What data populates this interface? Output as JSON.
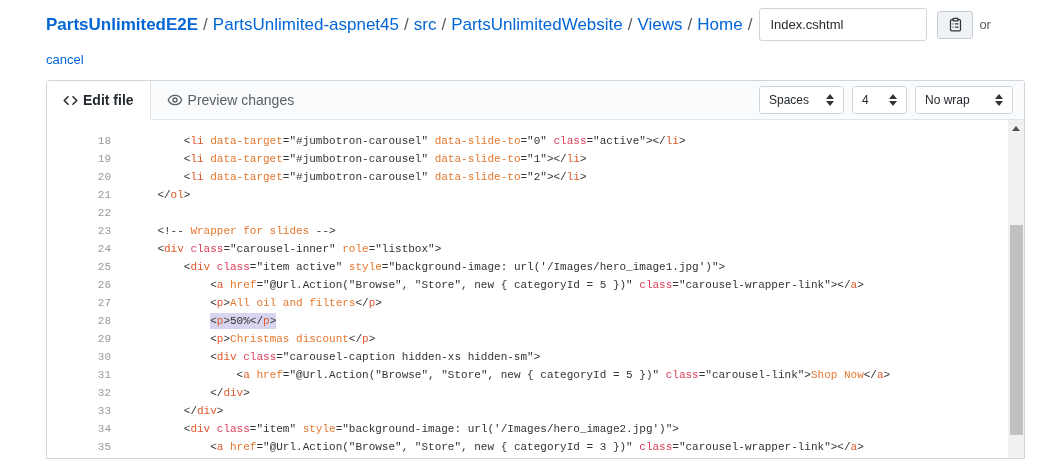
{
  "breadcrumb": [
    {
      "label": "PartsUnlimitedE2E",
      "kind": "repo",
      "separator": "/"
    },
    {
      "label": "PartsUnlimited-aspnet45",
      "kind": "dir",
      "separator": "/"
    },
    {
      "label": "src",
      "kind": "dir",
      "separator": "/"
    },
    {
      "label": "PartsUnlimitedWebsite",
      "kind": "dir",
      "separator": "/"
    },
    {
      "label": "Views",
      "kind": "dir",
      "separator": "/"
    },
    {
      "label": "Home",
      "kind": "dir",
      "separator": "/"
    }
  ],
  "filename": {
    "value": "Index.cshtml"
  },
  "or_text": "or",
  "cancel_link": "cancel",
  "tabs": [
    {
      "label": "Edit file",
      "selected": true
    },
    {
      "label": "Preview changes",
      "selected": false
    }
  ],
  "selects": [
    {
      "value": "Spaces"
    },
    {
      "value": "4"
    },
    {
      "value": "No wrap"
    }
  ],
  "code_lines": [
    {
      "number": "18",
      "selected": false,
      "tokens": [
        {
          "kind": "punct",
          "text": "        <"
        },
        {
          "kind": "tag",
          "text": "li"
        },
        {
          "kind": "attr",
          "text": " data-target"
        },
        {
          "kind": "punct",
          "text": "=\"#jumbotron-carousel\""
        },
        {
          "kind": "attr",
          "text": " data-slide-to"
        },
        {
          "kind": "punct",
          "text": "=\"0\""
        },
        {
          "kind": "keyword",
          "text": " class"
        },
        {
          "kind": "punct",
          "text": "=\"active\"></"
        },
        {
          "kind": "tag",
          "text": "li"
        },
        {
          "kind": "punct",
          "text": ">"
        }
      ]
    },
    {
      "number": "19",
      "selected": false,
      "tokens": [
        {
          "kind": "punct",
          "text": "        <"
        },
        {
          "kind": "tag",
          "text": "li"
        },
        {
          "kind": "attr",
          "text": " data-target"
        },
        {
          "kind": "punct",
          "text": "=\"#jumbotron-carousel\""
        },
        {
          "kind": "attr",
          "text": " data-slide-to"
        },
        {
          "kind": "punct",
          "text": "=\"1\"></"
        },
        {
          "kind": "tag",
          "text": "li"
        },
        {
          "kind": "punct",
          "text": ">"
        }
      ]
    },
    {
      "number": "20",
      "selected": false,
      "tokens": [
        {
          "kind": "punct",
          "text": "        <"
        },
        {
          "kind": "tag",
          "text": "li"
        },
        {
          "kind": "attr",
          "text": " data-target"
        },
        {
          "kind": "punct",
          "text": "=\"#jumbotron-carousel\""
        },
        {
          "kind": "attr",
          "text": " data-slide-to"
        },
        {
          "kind": "punct",
          "text": "=\"2\"></"
        },
        {
          "kind": "tag",
          "text": "li"
        },
        {
          "kind": "punct",
          "text": ">"
        }
      ]
    },
    {
      "number": "21",
      "selected": false,
      "tokens": [
        {
          "kind": "punct",
          "text": "    </"
        },
        {
          "kind": "tag",
          "text": "ol"
        },
        {
          "kind": "punct",
          "text": ">"
        }
      ]
    },
    {
      "number": "22"
    },
    {
      "number": "23",
      "selected": false,
      "tokens": [
        {
          "kind": "punct",
          "text": "    <!--"
        },
        {
          "kind": "comment",
          "text": " Wrapper for slides"
        },
        {
          "kind": "punct",
          "text": " -->"
        }
      ]
    },
    {
      "number": "24",
      "selected": false,
      "tokens": [
        {
          "kind": "punct",
          "text": "    <"
        },
        {
          "kind": "tag",
          "text": "div"
        },
        {
          "kind": "keyword",
          "text": " class"
        },
        {
          "kind": "punct",
          "text": "=\"carousel-inner\""
        },
        {
          "kind": "attr",
          "text": " role"
        },
        {
          "kind": "punct",
          "text": "=\"listbox\">"
        }
      ]
    },
    {
      "number": "25",
      "selected": false,
      "tokens": [
        {
          "kind": "punct",
          "text": "        <"
        },
        {
          "kind": "tag",
          "text": "div"
        },
        {
          "kind": "keyword",
          "text": " class"
        },
        {
          "kind": "punct",
          "text": "=\"item active\""
        },
        {
          "kind": "attr",
          "text": " style"
        },
        {
          "kind": "punct",
          "text": "=\"background-image: url('/Images/hero_image1.jpg')\">"
        }
      ]
    },
    {
      "number": "26",
      "selected": false,
      "tokens": [
        {
          "kind": "punct",
          "text": "            <"
        },
        {
          "kind": "tag",
          "text": "a"
        },
        {
          "kind": "attr",
          "text": " href"
        },
        {
          "kind": "punct",
          "text": "=\"@Url.Action(\"Browse\", \"Store\", new { categoryId = 5 })\""
        },
        {
          "kind": "keyword",
          "text": " class"
        },
        {
          "kind": "punct",
          "text": "=\"carousel-wrapper-link\"></"
        },
        {
          "kind": "tag",
          "text": "a"
        },
        {
          "kind": "punct",
          "text": ">"
        }
      ]
    },
    {
      "number": "27",
      "selected": false,
      "tokens": [
        {
          "kind": "punct",
          "text": "            <"
        },
        {
          "kind": "tag",
          "text": "p"
        },
        {
          "kind": "punct",
          "text": ">"
        },
        {
          "kind": "content",
          "text": "All oil and filters"
        },
        {
          "kind": "punct",
          "text": "</"
        },
        {
          "kind": "tag",
          "text": "p"
        },
        {
          "kind": "punct",
          "text": ">"
        }
      ]
    },
    {
      "number": "28",
      "selected": true,
      "tokens": [
        {
          "kind": "punct",
          "text": "            <"
        },
        {
          "kind": "tag",
          "text": "p"
        },
        {
          "kind": "punct",
          "text": ">50%</"
        },
        {
          "kind": "tag",
          "text": "p"
        },
        {
          "kind": "punct",
          "text": ">"
        }
      ]
    },
    {
      "number": "29",
      "selected": false,
      "tokens": [
        {
          "kind": "punct",
          "text": "            <"
        },
        {
          "kind": "tag",
          "text": "p"
        },
        {
          "kind": "punct",
          "text": ">"
        },
        {
          "kind": "content",
          "text": "Christmas discount"
        },
        {
          "kind": "punct",
          "text": "</"
        },
        {
          "kind": "tag",
          "text": "p"
        },
        {
          "kind": "punct",
          "text": ">"
        }
      ]
    },
    {
      "number": "30",
      "selected": false,
      "tokens": [
        {
          "kind": "punct",
          "text": "            <"
        },
        {
          "kind": "tag",
          "text": "div"
        },
        {
          "kind": "keyword",
          "text": " class"
        },
        {
          "kind": "punct",
          "text": "=\"carousel-caption hidden-xs hidden-sm\">"
        }
      ]
    },
    {
      "number": "31",
      "selected": false,
      "tokens": [
        {
          "kind": "punct",
          "text": "                <"
        },
        {
          "kind": "tag",
          "text": "a"
        },
        {
          "kind": "attr",
          "text": " href"
        },
        {
          "kind": "punct",
          "text": "=\"@Url.Action(\"Browse\", \"Store\", new { categoryId = 5 })\""
        },
        {
          "kind": "keyword",
          "text": " class"
        },
        {
          "kind": "punct",
          "text": "=\"carousel-link\">"
        },
        {
          "kind": "content",
          "text": "Shop Now"
        },
        {
          "kind": "punct",
          "text": "</"
        },
        {
          "kind": "tag",
          "text": "a"
        },
        {
          "kind": "punct",
          "text": ">"
        }
      ]
    },
    {
      "number": "32",
      "selected": false,
      "tokens": [
        {
          "kind": "punct",
          "text": "            </"
        },
        {
          "kind": "tag",
          "text": "div"
        },
        {
          "kind": "punct",
          "text": ">"
        }
      ]
    },
    {
      "number": "33",
      "selected": false,
      "tokens": [
        {
          "kind": "punct",
          "text": "        </"
        },
        {
          "kind": "tag",
          "text": "div"
        },
        {
          "kind": "punct",
          "text": ">"
        }
      ]
    },
    {
      "number": "34",
      "selected": false,
      "tokens": [
        {
          "kind": "punct",
          "text": "        <"
        },
        {
          "kind": "tag",
          "text": "div"
        },
        {
          "kind": "keyword",
          "text": " class"
        },
        {
          "kind": "punct",
          "text": "=\"item\""
        },
        {
          "kind": "attr",
          "text": " style"
        },
        {
          "kind": "punct",
          "text": "=\"background-image: url('/Images/hero_image2.jpg')\">"
        }
      ]
    },
    {
      "number": "35",
      "selected": false,
      "tokens": [
        {
          "kind": "punct",
          "text": "            <"
        },
        {
          "kind": "tag",
          "text": "a"
        },
        {
          "kind": "attr",
          "text": " href"
        },
        {
          "kind": "punct",
          "text": "=\"@Url.Action(\"Browse\", \"Store\", new { categoryId = 3 })\""
        },
        {
          "kind": "keyword",
          "text": " class"
        },
        {
          "kind": "punct",
          "text": "=\"carousel-wrapper-link\"></"
        },
        {
          "kind": "tag",
          "text": "a"
        },
        {
          "kind": "punct",
          "text": ">"
        }
      ]
    }
  ]
}
